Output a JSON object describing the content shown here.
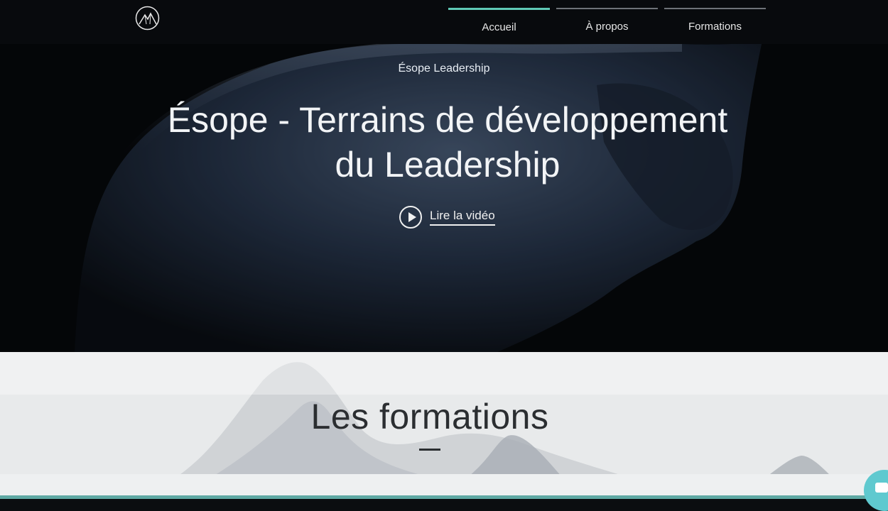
{
  "nav": {
    "items": [
      {
        "label": "Accueil",
        "active": true
      },
      {
        "label": "À propos",
        "active": false
      },
      {
        "label": "Formations",
        "active": false
      }
    ],
    "logo_icon": "mountain-circle-logo"
  },
  "hero": {
    "eyebrow": "Ésope Leadership",
    "title_line1": "Ésope - Terrains de développement",
    "title_line2": "du Leadership",
    "video_label": "Lire la vidéo",
    "play_icon": "play-icon"
  },
  "section": {
    "title": "Les formations"
  },
  "colors": {
    "accent": "#5fc9b6",
    "hero_bg": "#07090c",
    "section_bg": "#e7e9ea"
  }
}
